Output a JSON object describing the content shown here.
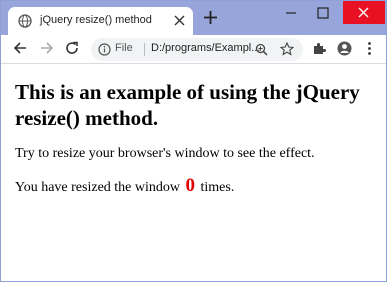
{
  "tab": {
    "title": "jQuery resize() method"
  },
  "toolbar": {
    "scheme": "File",
    "url": "D:/programs/Exampl..."
  },
  "page": {
    "heading": "This is an example of using the jQuery resize() method.",
    "instruction": "Try to resize your browser's window to see the effect.",
    "count_prefix": "You have resized the window",
    "count_value": "0",
    "count_suffix": "times."
  },
  "colors": {
    "tabstrip": "#97a5db",
    "count": "#e60000",
    "close_button": "#e81123"
  }
}
